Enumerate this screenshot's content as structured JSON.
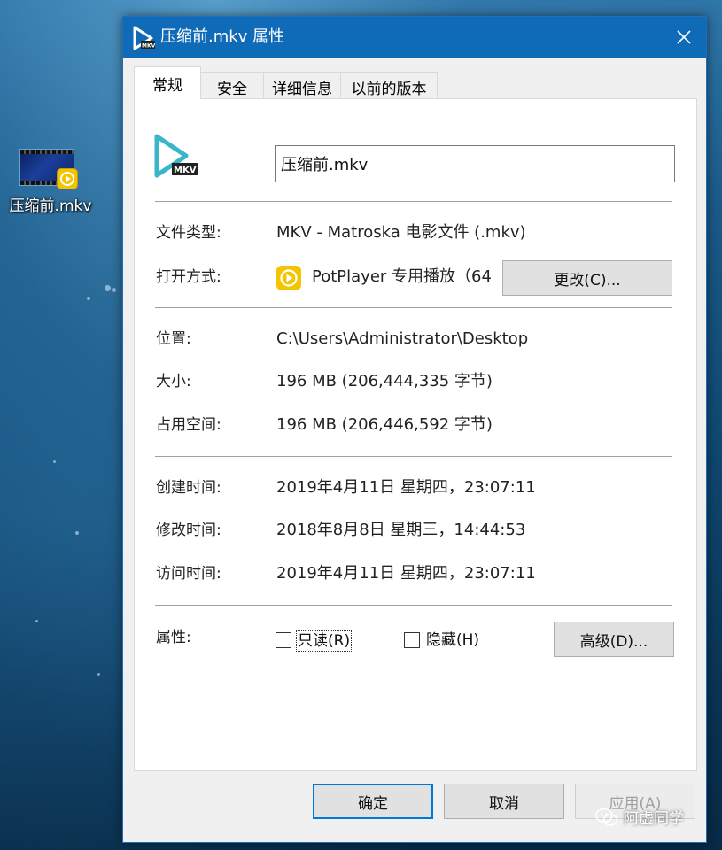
{
  "window": {
    "title": "压缩前.mkv 属性"
  },
  "desktop": {
    "file_label": "压缩前.mkv"
  },
  "tabs": [
    {
      "label": "常规",
      "active": true
    },
    {
      "label": "安全",
      "active": false
    },
    {
      "label": "详细信息",
      "active": false
    },
    {
      "label": "以前的版本",
      "active": false
    }
  ],
  "general": {
    "file_icon_text": "MKV",
    "file_name": "压缩前.mkv",
    "file_type_label": "文件类型:",
    "file_type_value": "MKV - Matroska 电影文件 (.mkv)",
    "open_with_label": "打开方式:",
    "open_with_value": "PotPlayer 专用播放（64",
    "change_button": "更改(C)...",
    "location_label": "位置:",
    "location_value": "C:\\Users\\Administrator\\Desktop",
    "size_label": "大小:",
    "size_value": "196 MB (206,444,335 字节)",
    "size_on_disk_label": "占用空间:",
    "size_on_disk_value": "196 MB (206,446,592 字节)",
    "created_label": "创建时间:",
    "created_value": "2019年4月11日 星期四，23:07:11",
    "modified_label": "修改时间:",
    "modified_value": "2018年8月8日 星期三，14:44:53",
    "accessed_label": "访问时间:",
    "accessed_value": "2019年4月11日 星期四，23:07:11",
    "attributes_label": "属性:",
    "readonly_label": "只读(R)",
    "hidden_label": "隐藏(H)",
    "advanced_button": "高级(D)..."
  },
  "footer": {
    "ok": "确定",
    "cancel": "取消",
    "apply": "应用(A)"
  },
  "watermark": "阿虚同学",
  "colors": {
    "titlebar": "#0f6ab8",
    "potplayer": "#f5c400",
    "mkv_icon": "#3bb5c8"
  }
}
